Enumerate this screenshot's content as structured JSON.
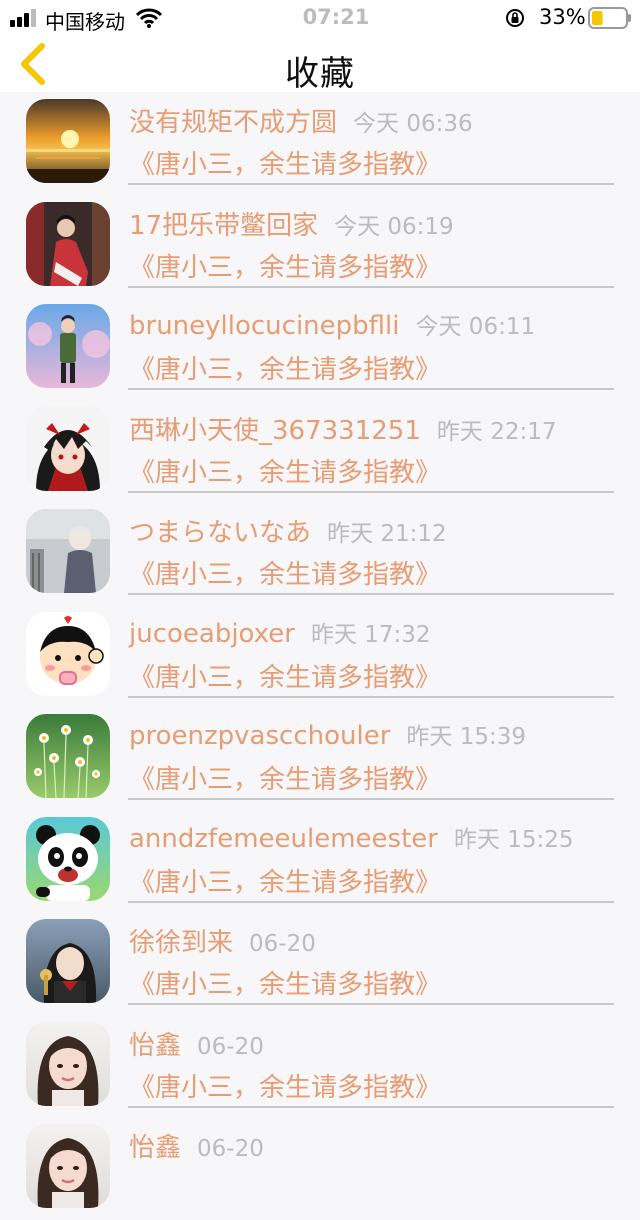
{
  "status_bar": {
    "carrier": "中国移动",
    "time": "07:21",
    "battery": "33%",
    "signal_icon": "signal-bars-icon",
    "wifi_icon": "wifi-icon",
    "lock_icon": "orientation-lock-icon",
    "battery_level": 0.33,
    "battery_color": "#f6c700"
  },
  "nav": {
    "title": "收藏",
    "back_icon": "chevron-left-icon",
    "back_color": "#f6c700"
  },
  "colors": {
    "accent_text": "#e79d74",
    "time_text": "#bcbcbc"
  },
  "items": [
    {
      "name": "没有规矩不成方圆",
      "time": "今天 06:36",
      "content": "《唐小三，余生请多指教》",
      "avatar": "sunset"
    },
    {
      "name": "17把乐带鳖回家",
      "time": "今天 06:19",
      "content": "《唐小三，余生请多指教》",
      "avatar": "person-red"
    },
    {
      "name": "bruneyllocucinepbflli",
      "time": "今天 06:11",
      "content": "《唐小三，余生请多指教》",
      "avatar": "person-sky"
    },
    {
      "name": "西琳小天使_367331251",
      "time": "昨天 22:17",
      "content": "《唐小三，余生请多指教》",
      "avatar": "anime-red"
    },
    {
      "name": "つまらないなあ",
      "time": "昨天 21:12",
      "content": "《唐小三，余生请多指教》",
      "avatar": "anime-grey"
    },
    {
      "name": "jucoeabjoxer",
      "time": "昨天 17:32",
      "content": "《唐小三，余生请多指教》",
      "avatar": "cartoon-kid"
    },
    {
      "name": "proenzpvascchouler",
      "time": "昨天 15:39",
      "content": "《唐小三，余生请多指教》",
      "avatar": "daisies"
    },
    {
      "name": "anndzfemeeulemeester",
      "time": "昨天 15:25",
      "content": "《唐小三，余生请多指教》",
      "avatar": "panda"
    },
    {
      "name": "徐徐到来",
      "time": "06-20",
      "content": "《唐小三，余生请多指教》",
      "avatar": "anime-dark"
    },
    {
      "name": "怡鑫",
      "time": "06-20",
      "content": "《唐小三，余生请多指教》",
      "avatar": "woman"
    },
    {
      "name": "怡鑫",
      "time": "06-20",
      "content": "",
      "avatar": "woman"
    }
  ]
}
